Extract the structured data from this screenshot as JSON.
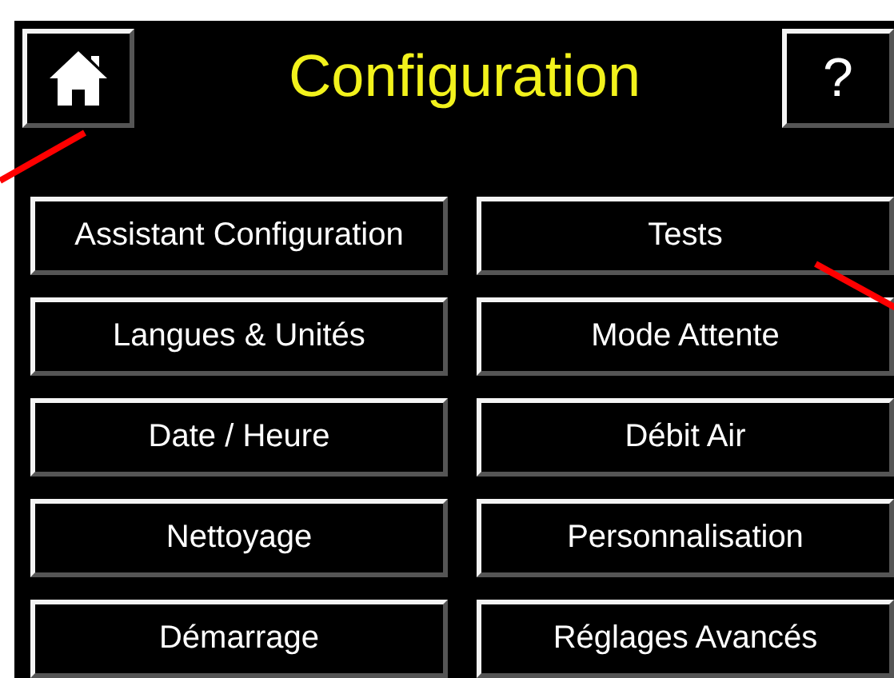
{
  "header": {
    "title": "Configuration",
    "help_button": "?"
  },
  "menu_buttons": [
    {
      "label": "Assistant Configuration"
    },
    {
      "label": "Tests"
    },
    {
      "label": "Langues & Unités"
    },
    {
      "label": "Mode Attente"
    },
    {
      "label": "Date / Heure"
    },
    {
      "label": "Débit Air"
    },
    {
      "label": "Nettoyage"
    },
    {
      "label": "Personnalisation"
    },
    {
      "label": "Démarrage"
    },
    {
      "label": "Réglages Avancés"
    }
  ]
}
